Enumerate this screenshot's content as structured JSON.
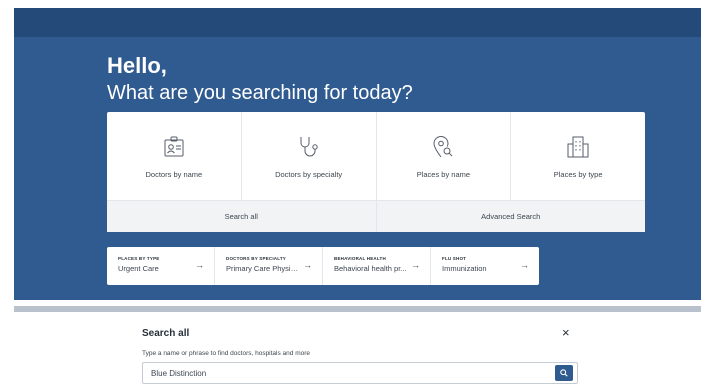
{
  "hero": {
    "greeting": "Hello,",
    "question": "What are you searching for today?"
  },
  "tiles": [
    {
      "label": "Doctors by name",
      "icon": "id-badge-icon"
    },
    {
      "label": "Doctors by specialty",
      "icon": "stethoscope-icon"
    },
    {
      "label": "Places by name",
      "icon": "map-pin-search-icon"
    },
    {
      "label": "Places by type",
      "icon": "building-icon"
    }
  ],
  "actions": {
    "search_all": "Search all",
    "advanced_search": "Advanced Search"
  },
  "quick_links": [
    {
      "category": "PLACES BY TYPE",
      "value": "Urgent Care"
    },
    {
      "category": "DOCTORS BY SPECIALTY",
      "value": "Primary Care Physic..."
    },
    {
      "category": "BEHAVIORAL HEALTH",
      "value": "Behavioral health pr..."
    },
    {
      "category": "FLU SHOT",
      "value": "Immunization"
    }
  ],
  "modal": {
    "title": "Search all",
    "close": "×",
    "help": "Type a name or phrase to find doctors, hospitals and more",
    "input_value": "Blue Distinction"
  },
  "colors": {
    "hero_bg": "#2f5b91",
    "topbar": "#244a79",
    "button": "#2f5b91"
  }
}
